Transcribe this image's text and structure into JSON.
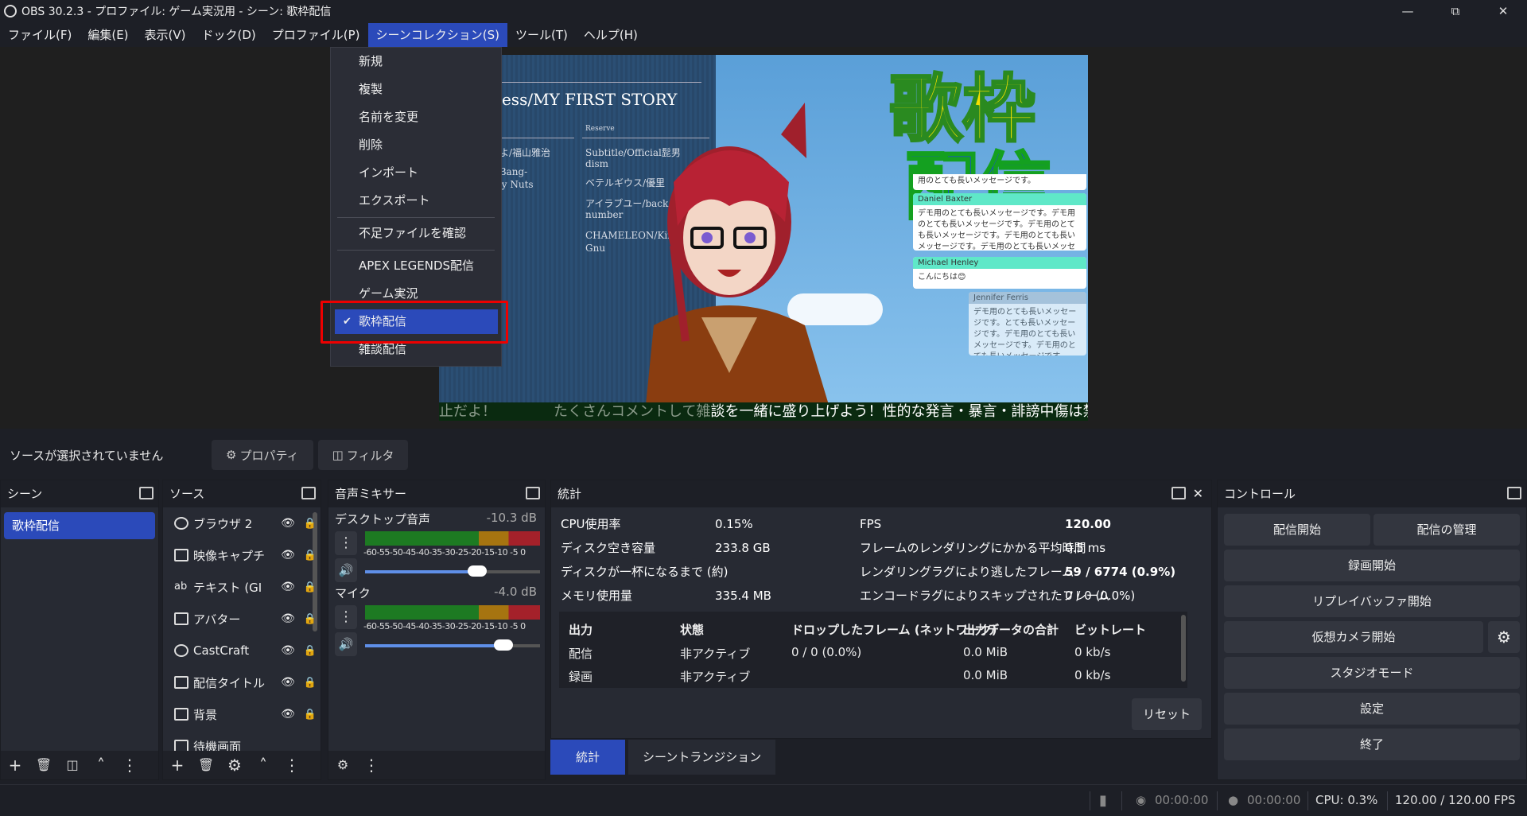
{
  "window": {
    "title": "OBS 30.2.3 - プロファイル: ゲーム実況用 - シーン: 歌枠配信"
  },
  "menu": [
    "ファイル(F)",
    "編集(E)",
    "表示(V)",
    "ドック(D)",
    "プロファイル(P)",
    "シーンコレクション(S)",
    "ツール(T)",
    "ヘルプ(H)"
  ],
  "scene_collection_menu": {
    "items_top": [
      "新規",
      "複製",
      "名前を変更",
      "削除",
      "インポート",
      "エクスポート"
    ],
    "check_missing": "不足ファイルを確認",
    "collections": [
      "APEX LEGENDS配信",
      "ゲーム実況",
      "歌枠配信",
      "雑談配信"
    ],
    "selected": "歌枠配信"
  },
  "preview": {
    "song_title": "mess/MY FIRST STORY",
    "reserve_label": "Reserve",
    "left_col": [
      "うよ/福山雅治",
      "g-Bang-",
      "epy Nuts"
    ],
    "right_col": [
      "Subtitle/Official髭男",
      "dism",
      "ベテルギウス/優里",
      "アイラブユー/back",
      "number",
      "CHAMELEON/King",
      "Gnu"
    ],
    "logo_line1": "歌枠",
    "logo_line2": "配信",
    "chat": [
      {
        "user": "Daniel Baxter",
        "text": "デモ用のとても長いメッセージです。デモ用のとても長いメッセージです。デモ用のとても長いメッセージです。デモ用のとても長いメッセージです。デモ用のとても長いメッセージです。"
      },
      {
        "user": "Michael Henley",
        "text": "こんにちは😊"
      },
      {
        "user": "Jennifer Ferris",
        "text": "デモ用のとても長いメッセージです。とても長いメッセージです。デモ用のとても長いメッセージです。デモ用のとても長いメッセージです。"
      }
    ],
    "chat_top_fragment": "用のとても長いメッセージです。",
    "ticker_dim": "止だよ！　　　　たくさんコメントして雑",
    "ticker_main": "談を一緒に盛り上げよう！性的な発言・暴言・誹謗中傷は禁"
  },
  "source_bar": {
    "no_source": "ソースが選択されていません",
    "properties": "プロパティ",
    "filters": "フィルタ"
  },
  "scenes": {
    "title": "シーン",
    "items": [
      "歌枠配信"
    ]
  },
  "sources": {
    "title": "ソース",
    "items": [
      {
        "name": "ブラウザ 2",
        "icon": "globe-icon"
      },
      {
        "name": "映像キャプチ",
        "icon": "camera-icon"
      },
      {
        "name": "テキスト (GI",
        "icon": "text-icon"
      },
      {
        "name": "アバター",
        "icon": "image-icon"
      },
      {
        "name": "CastCraft",
        "icon": "globe-icon"
      },
      {
        "name": "配信タイトル",
        "icon": "image-icon"
      },
      {
        "name": "背景",
        "icon": "image-icon"
      },
      {
        "name": "待機画面",
        "icon": "image-icon"
      }
    ]
  },
  "mixer": {
    "title": "音声ミキサー",
    "channels": [
      {
        "name": "デスクトップ音声",
        "db": "-10.3 dB",
        "level": 0.64
      },
      {
        "name": "マイク",
        "db": "-4.0 dB",
        "level": 0.79
      }
    ],
    "ticks": "-60-55-50-45-40-35-30-25-20-15-10 -5  0"
  },
  "stats": {
    "title": "統計",
    "rows_left": [
      {
        "label": "CPU使用率",
        "value": "0.15%"
      },
      {
        "label": "ディスク空き容量",
        "value": "233.8 GB"
      },
      {
        "label": "ディスクが一杯になるまで (約)",
        "value": ""
      },
      {
        "label": "メモリ使用量",
        "value": "335.4 MB"
      }
    ],
    "rows_right": [
      {
        "label": "FPS",
        "value": "120.00"
      },
      {
        "label": "フレームのレンダリングにかかる平均時間",
        "value": "0.5 ms"
      },
      {
        "label": "レンダリングラグにより逃したフレーム",
        "value": "59 / 6774 (0.9%)"
      },
      {
        "label": "エンコードラグによりスキップされたフレーム",
        "value": "0 / 0 (0.0%)"
      }
    ],
    "output_headers": [
      "出力",
      "状態",
      "ドロップしたフレーム (ネットワーク)",
      "出力データの合計",
      "ビットレート"
    ],
    "outputs": [
      [
        "配信",
        "非アクティブ",
        "0 / 0 (0.0%)",
        "0.0 MiB",
        "0 kb/s"
      ],
      [
        "録画",
        "非アクティブ",
        "",
        "0.0 MiB",
        "0 kb/s"
      ]
    ],
    "reset": "リセット"
  },
  "tabs": [
    "統計",
    "シーントランジション"
  ],
  "controls": {
    "title": "コントロール",
    "start_stream": "配信開始",
    "manage_stream": "配信の管理",
    "start_record": "録画開始",
    "start_replay": "リプレイバッファ開始",
    "start_vcam": "仮想カメラ開始",
    "studio_mode": "スタジオモード",
    "settings": "設定",
    "exit": "終了"
  },
  "status": {
    "stream_time": "00:00:00",
    "rec_time": "00:00:00",
    "cpu": "CPU: 0.3%",
    "fps": "120.00 / 120.00 FPS"
  }
}
